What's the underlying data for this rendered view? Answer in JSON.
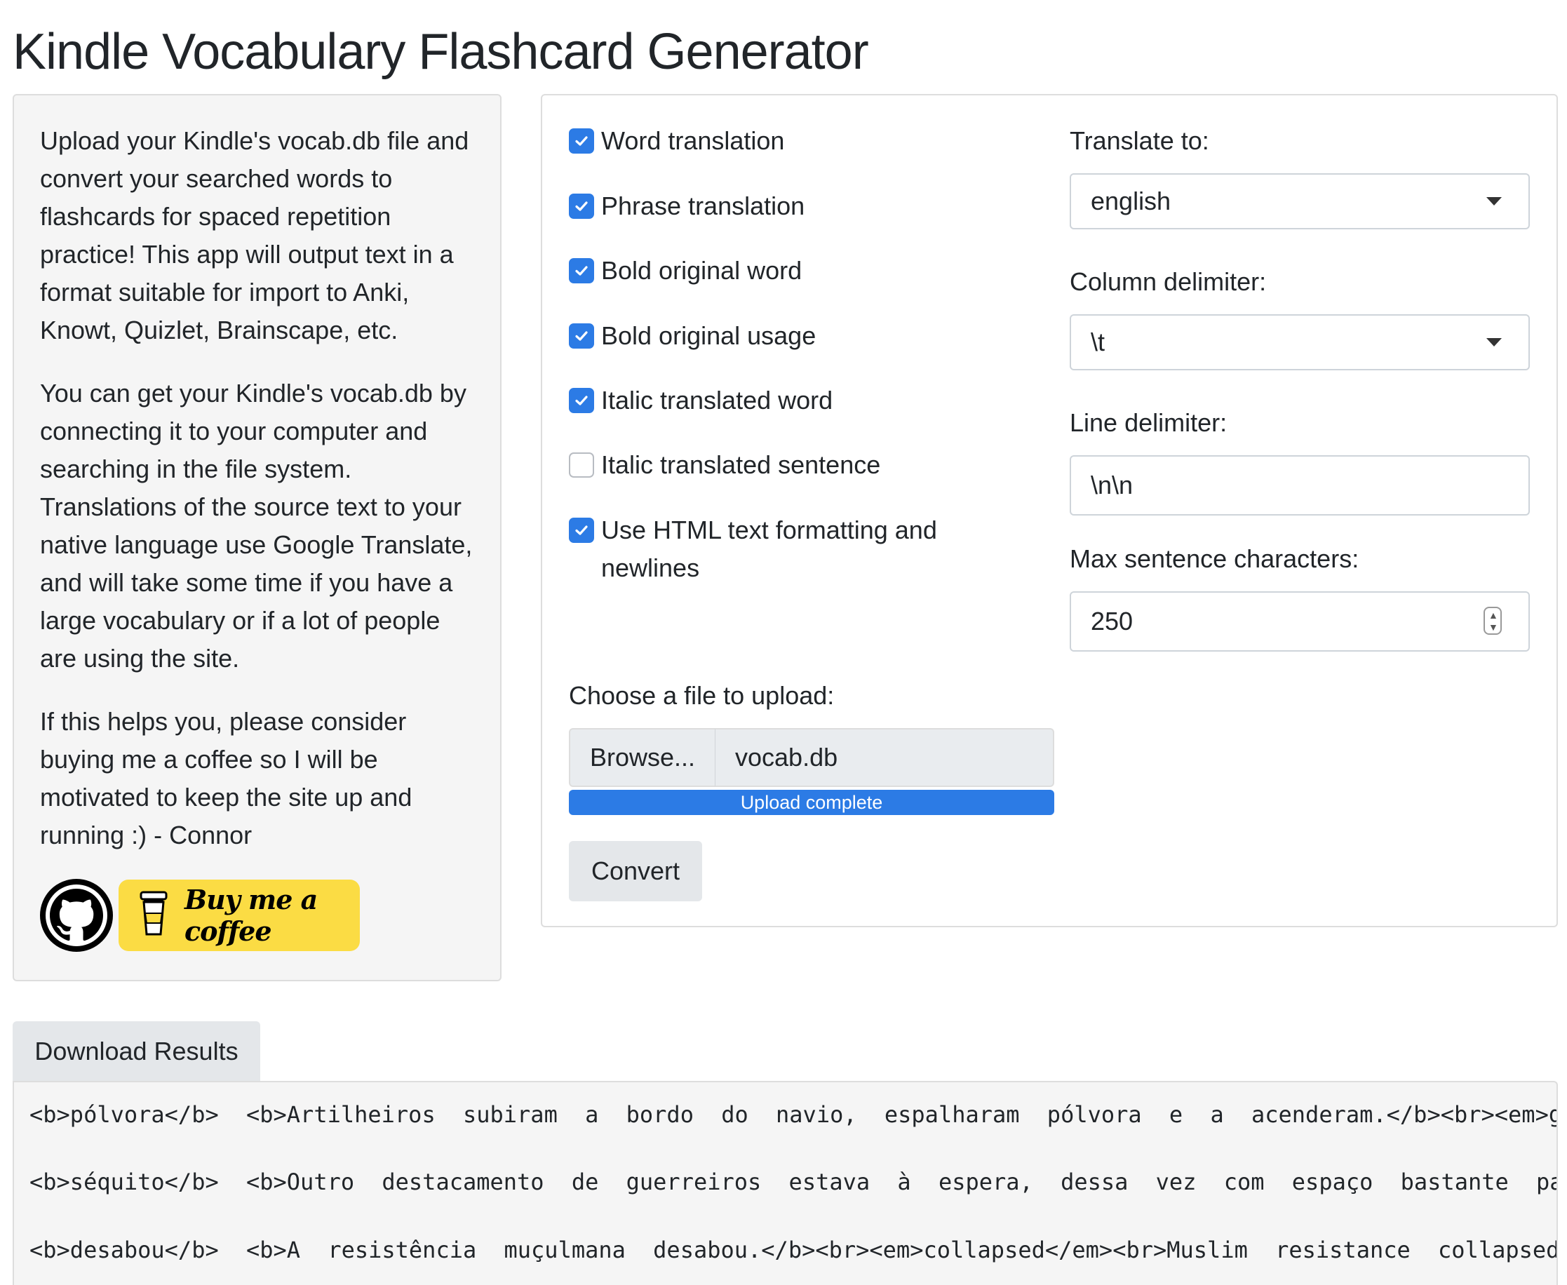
{
  "page": {
    "title": "Kindle Vocabulary Flashcard Generator"
  },
  "sidebar": {
    "paragraphs": [
      "Upload your Kindle's vocab.db file and convert your searched words to flashcards for spaced repetition practice! This app will output text in a format suitable for import to Anki, Knowt, Quizlet, Brainscape, etc.",
      "You can get your Kindle's vocab.db by connecting it to your computer and searching in the file system. Translations of the source text to your native language use Google Translate, and will take some time if you have a large vocabulary or if a lot of people are using the site.",
      "If this helps you, please consider buying me a coffee so I will be motivated to keep the site up and running :) - Connor"
    ],
    "github_icon": "github-icon",
    "coffee_label": "Buy me a coffee",
    "coffee_color": "#fbdc44"
  },
  "options": {
    "checkboxes": [
      {
        "label": "Word translation",
        "checked": true
      },
      {
        "label": "Phrase translation",
        "checked": true
      },
      {
        "label": "Bold original word",
        "checked": true
      },
      {
        "label": "Bold original usage",
        "checked": true
      },
      {
        "label": "Italic translated word",
        "checked": true
      },
      {
        "label": "Italic translated sentence",
        "checked": false
      },
      {
        "label": "Use HTML text formatting and newlines",
        "checked": true
      }
    ],
    "translate_to": {
      "label": "Translate to:",
      "value": "english"
    },
    "column_delimiter": {
      "label": "Column delimiter:",
      "value": "\\t"
    },
    "line_delimiter": {
      "label": "Line delimiter:",
      "value": "\\n\\n"
    },
    "max_sentence": {
      "label": "Max sentence characters:",
      "value": "250"
    },
    "upload": {
      "label": "Choose a file to upload:",
      "browse_label": "Browse...",
      "filename": "vocab.db",
      "progress_text": "Upload complete",
      "progress": 1.0
    },
    "convert_label": "Convert",
    "accent_color": "#2c7be5"
  },
  "results": {
    "download_label": "Download Results",
    "lines": [
      "<b>pólvora</b> <b>Artilheiros subiram a bordo do navio, espalharam pólvora e a acenderam.</b><br><em>g",
      "<b>séquito</b> <b>Outro destacamento de guerreiros estava à espera, dessa vez com espaço bastante pa",
      "<b>desabou</b> <b>A resistência muçulmana desabou.</b><br><em>collapsed</em><br>Muslim resistance collapsed"
    ]
  }
}
